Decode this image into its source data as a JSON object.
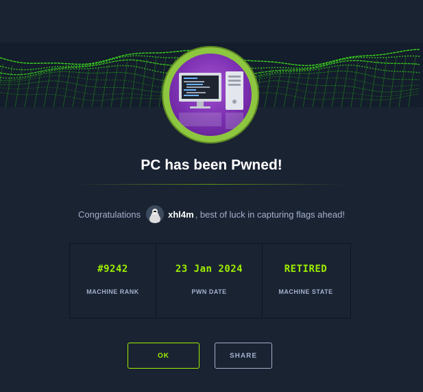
{
  "dialog": {
    "title": "PC has been Pwned!",
    "congrats_prefix": "Congratulations",
    "username": "xhl4m",
    "congrats_suffix": ", best of luck in capturing flags ahead!"
  },
  "stats": [
    {
      "value": "#9242",
      "label": "MACHINE RANK"
    },
    {
      "value": "23 Jan 2024",
      "label": "PWN DATE"
    },
    {
      "value": "RETIRED",
      "label": "MACHINE STATE"
    }
  ],
  "buttons": {
    "ok": "OK",
    "share": "SHARE"
  },
  "colors": {
    "background": "#1a2332",
    "accent": "#9fef00",
    "badge_ring": "#8dc63f",
    "badge_fill": "#7a2fb0",
    "muted_text": "#a4b1cd"
  },
  "icons": {
    "badge": "computer-monitor-and-tower-icon",
    "avatar": "user-avatar"
  }
}
